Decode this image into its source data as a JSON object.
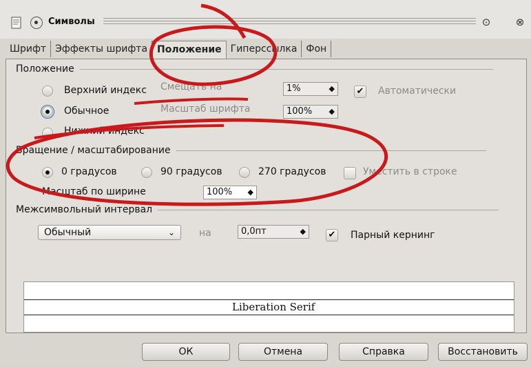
{
  "window": {
    "title": "Символы"
  },
  "tabs": [
    {
      "label": "Шрифт"
    },
    {
      "label": "Эффекты шрифта"
    },
    {
      "label": "Положение"
    },
    {
      "label": "Гиперссылка"
    },
    {
      "label": "Фон"
    }
  ],
  "position": {
    "heading": "Положение",
    "superscript": "Верхний индекс",
    "normal": "Обычное",
    "subscript": "Нижний индекс",
    "raise_label": "Смещать на",
    "raise_value": "1%",
    "font_scale_label": "Масштаб шрифта",
    "font_scale_value": "100%",
    "auto_label": "Автоматически"
  },
  "rotation": {
    "heading": "Вращение / масштабирование",
    "deg0": "0 градусов",
    "deg90": "90 градусов",
    "deg270": "270 градусов",
    "fit_to_line": "Уместить в строке",
    "scale_width_label": "Масштаб по ширине",
    "scale_width_value": "100%"
  },
  "spacing": {
    "heading": "Межсимвольный интервал",
    "mode": "Обычный",
    "by_label": "на",
    "by_value": "0,0пт",
    "pair_kerning": "Парный кернинг"
  },
  "preview": {
    "font_name": "Liberation Serif"
  },
  "buttons": {
    "ok": "ОК",
    "cancel": "Отмена",
    "help": "Справка",
    "reset": "Восстановить"
  },
  "colors": {
    "annotation": "#c8191b",
    "focus": "#3b72b6"
  }
}
